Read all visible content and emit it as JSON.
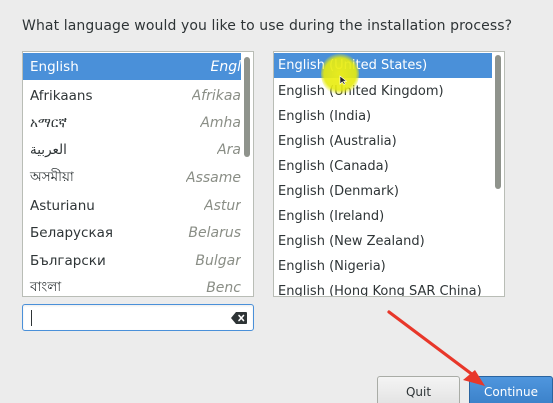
{
  "prompt": "What language would you like to use during the installation process?",
  "languages": [
    {
      "native": "English",
      "translated": "Engl",
      "selected": true
    },
    {
      "native": "Afrikaans",
      "translated": "Afrikaa"
    },
    {
      "native": "አማርኛ",
      "translated": "Amha"
    },
    {
      "native": "العربية",
      "translated": "Ara"
    },
    {
      "native": "অসমীয়া",
      "translated": "Assame"
    },
    {
      "native": "Asturianu",
      "translated": "Astur"
    },
    {
      "native": "Беларуская",
      "translated": "Belarus"
    },
    {
      "native": "Български",
      "translated": "Bulgar"
    },
    {
      "native": "বাংলা",
      "translated": "Benc"
    }
  ],
  "locales": [
    {
      "label": "English (United States)",
      "selected": true
    },
    {
      "label": "English (United Kingdom)"
    },
    {
      "label": "English (India)"
    },
    {
      "label": "English (Australia)"
    },
    {
      "label": "English (Canada)"
    },
    {
      "label": "English (Denmark)"
    },
    {
      "label": "English (Ireland)"
    },
    {
      "label": "English (New Zealand)"
    },
    {
      "label": "English (Nigeria)"
    },
    {
      "label": "English (Hong Kong SAR China)"
    }
  ],
  "search": {
    "value": "",
    "clear_icon": "backspace-icon"
  },
  "buttons": {
    "quit": "Quit",
    "continue": "Continue"
  },
  "colors": {
    "selection": "#4a90d9",
    "highlight": "#f0f014",
    "arrow": "#e8372a"
  }
}
